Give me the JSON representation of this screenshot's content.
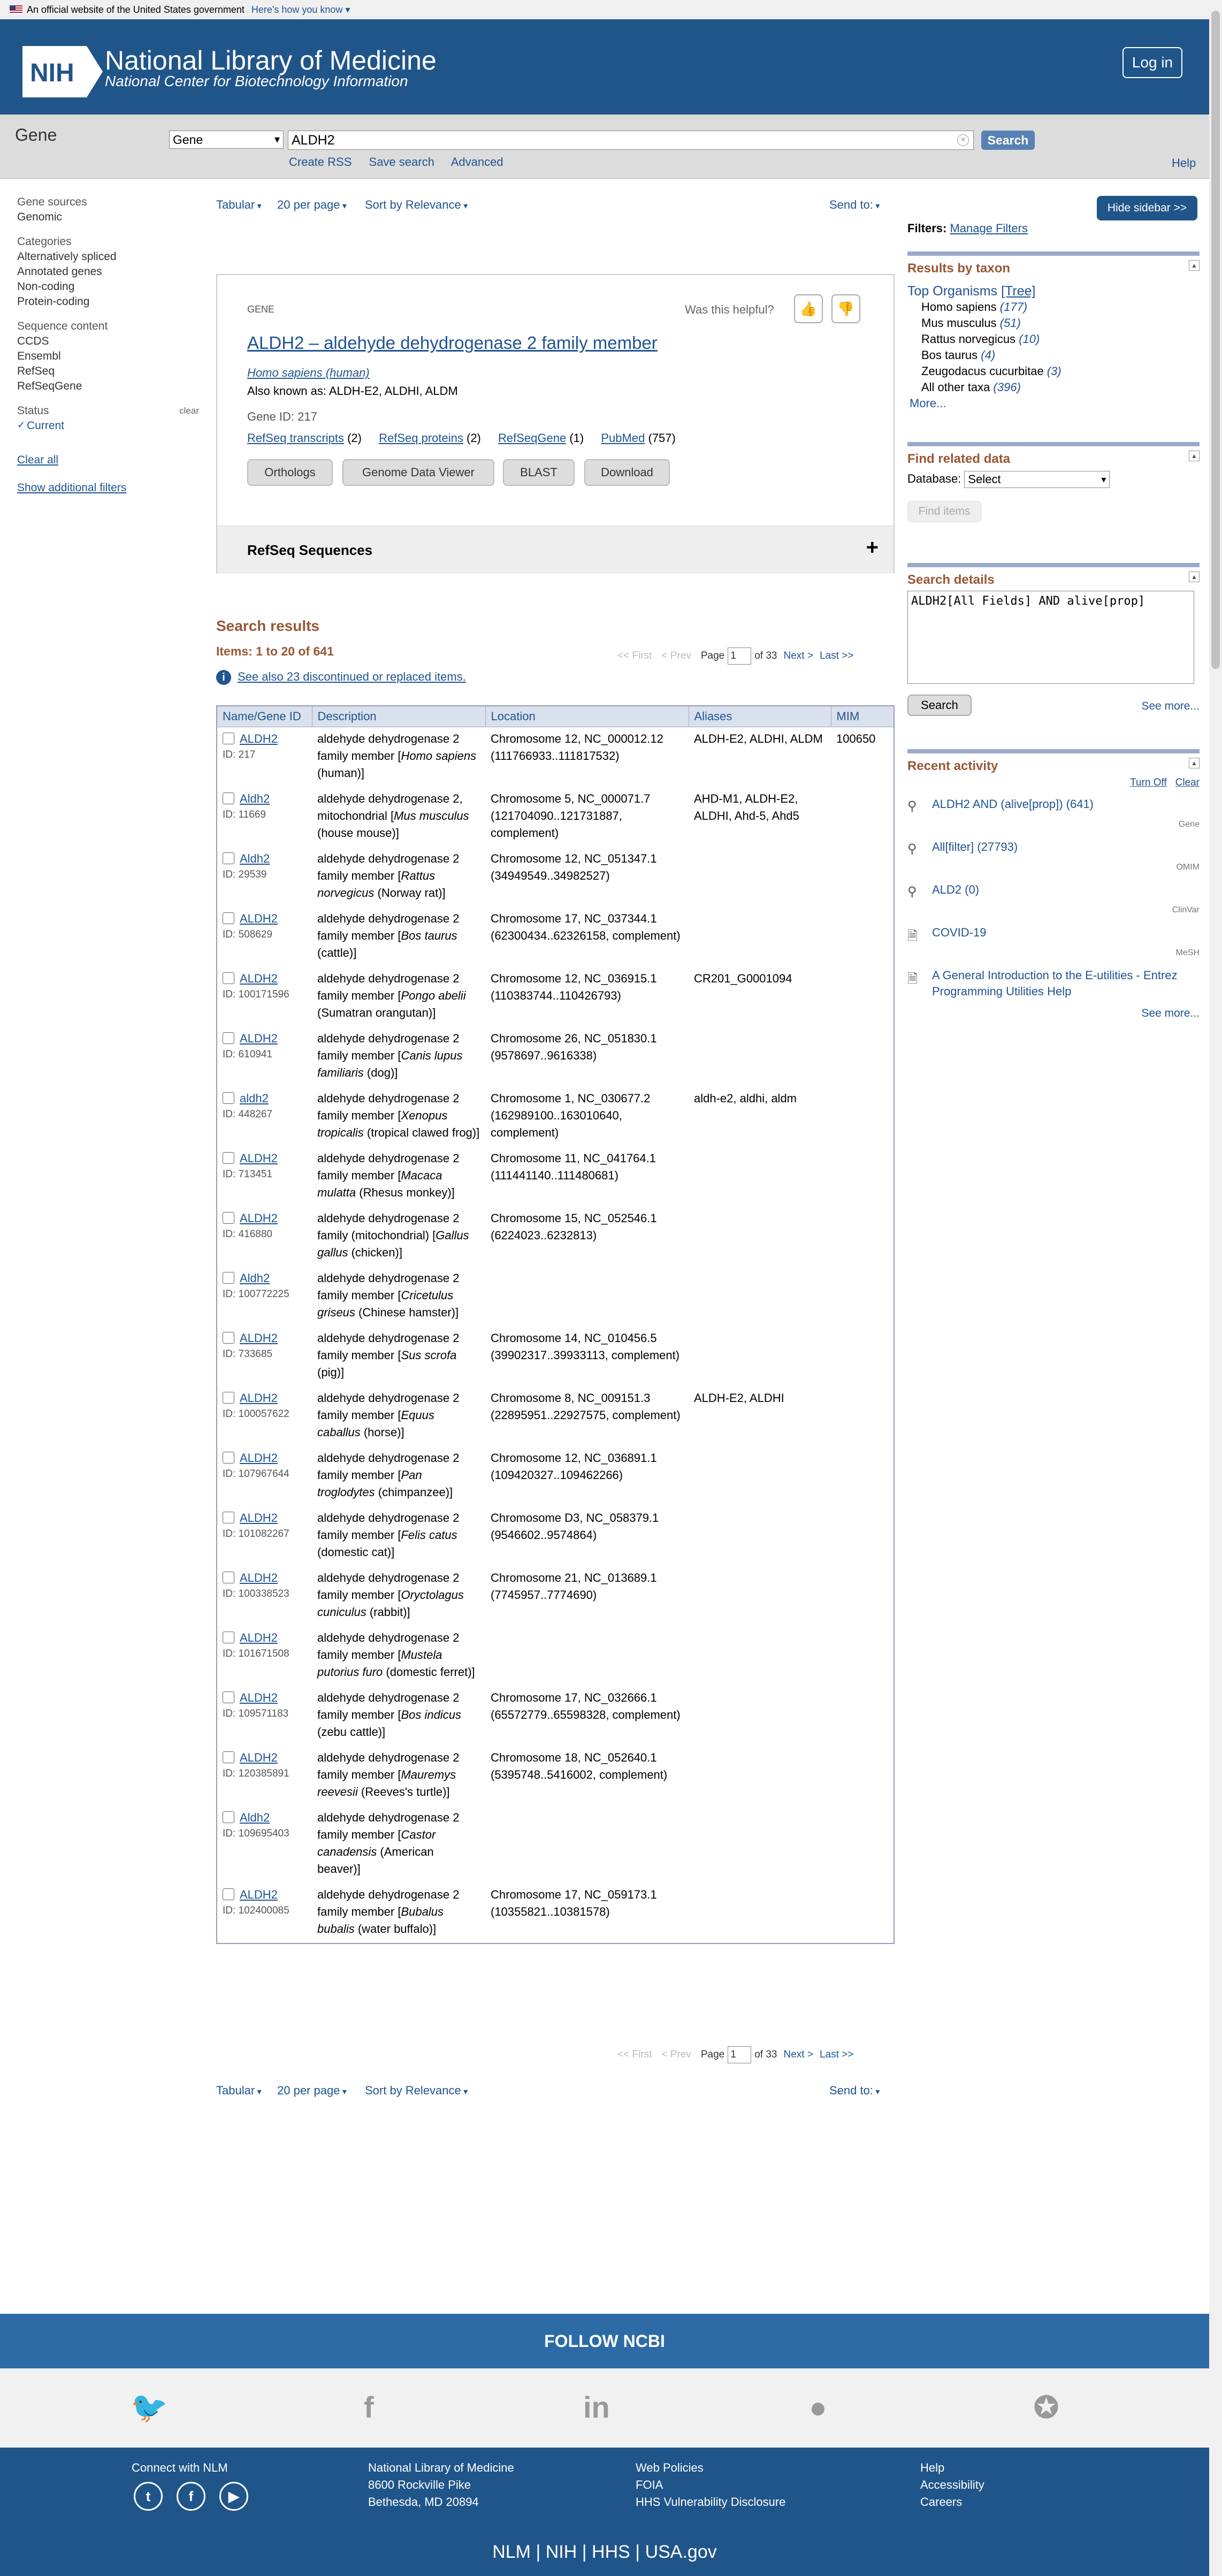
{
  "banner": {
    "text": "An official website of the United States government",
    "link": "Here's how you know"
  },
  "header": {
    "logo": "NIH",
    "title": "National Library of Medicine",
    "subtitle": "National Center for Biotechnology Information",
    "login": "Log in"
  },
  "search": {
    "db_name": "Gene",
    "db_select": "Gene",
    "term": "ALDH2",
    "button": "Search",
    "links": [
      "Create RSS",
      "Save search",
      "Advanced"
    ],
    "help": "Help"
  },
  "leftnav": {
    "gene_sources_h": "Gene sources",
    "gene_sources": [
      "Genomic"
    ],
    "categories_h": "Categories",
    "categories": [
      "Alternatively spliced",
      "Annotated genes",
      "Non-coding",
      "Protein-coding"
    ],
    "seq_h": "Sequence content",
    "seq": [
      "CCDS",
      "Ensembl",
      "RefSeq",
      "RefSeqGene"
    ],
    "status_h": "Status",
    "status_clear": "clear",
    "status_current": "Current",
    "clear_all": "Clear all",
    "show_filters": "Show additional filters"
  },
  "toolbar": {
    "format": "Tabular",
    "per_page": "20 per page",
    "sort": "Sort by Relevance",
    "send": "Send to:"
  },
  "gene_box": {
    "label": "GENE",
    "helpful": "Was this helpful?",
    "title": "ALDH2 – aldehyde dehydrogenase 2 family member",
    "organism": "Homo sapiens (human)",
    "aka": "Also known as: ALDH-E2, ALDHI, ALDM",
    "gene_id": "Gene ID: 217",
    "links": [
      {
        "label": "RefSeq transcripts",
        "count": "(2)"
      },
      {
        "label": "RefSeq proteins",
        "count": "(2)"
      },
      {
        "label": "RefSeqGene",
        "count": "(1)"
      },
      {
        "label": "PubMed",
        "count": "(757)"
      }
    ],
    "buttons": [
      "Orthologs",
      "Genome Data Viewer",
      "BLAST",
      "Download"
    ],
    "refseq": "RefSeq Sequences"
  },
  "results": {
    "title": "Search results",
    "items": "Items: 1 to 20 of 641",
    "see_also": "See also 23 discontinued or replaced items.",
    "pager": {
      "first": "<< First",
      "prev": "< Prev",
      "page_label": "Page",
      "page": "1",
      "of": "of 33",
      "next": "Next >",
      "last": "Last >>"
    },
    "columns": [
      "Name/Gene ID",
      "Description",
      "Location",
      "Aliases",
      "MIM"
    ],
    "rows": [
      {
        "name": "ALDH2",
        "id": "ID: 217",
        "d1": "aldehyde dehydrogenase 2 family member [",
        "sp": "Homo sapiens",
        "d2": " (human)]",
        "loc": "Chromosome 12, NC_000012.12 (111766933..111817532)",
        "alias": "ALDH-E2, ALDHI, ALDM",
        "mim": "100650"
      },
      {
        "name": "Aldh2",
        "id": "ID: 11669",
        "d1": "aldehyde dehydrogenase 2, mitochondrial [",
        "sp": "Mus musculus",
        "d2": " (house mouse)]",
        "loc": "Chromosome 5, NC_000071.7 (121704090..121731887, complement)",
        "alias": "AHD-M1, ALDH-E2, ALDHI, Ahd-5, Ahd5",
        "mim": ""
      },
      {
        "name": "Aldh2",
        "id": "ID: 29539",
        "d1": "aldehyde dehydrogenase 2 family member [",
        "sp": "Rattus norvegicus",
        "d2": " (Norway rat)]",
        "loc": "Chromosome 12, NC_051347.1 (34949549..34982527)",
        "alias": "",
        "mim": ""
      },
      {
        "name": "ALDH2",
        "id": "ID: 508629",
        "d1": "aldehyde dehydrogenase 2 family member [",
        "sp": "Bos taurus",
        "d2": " (cattle)]",
        "loc": "Chromosome 17, NC_037344.1 (62300434..62326158, complement)",
        "alias": "",
        "mim": ""
      },
      {
        "name": "ALDH2",
        "id": "ID: 100171596",
        "d1": "aldehyde dehydrogenase 2 family member [",
        "sp": "Pongo abelii",
        "d2": " (Sumatran orangutan)]",
        "loc": "Chromosome 12, NC_036915.1 (110383744..110426793)",
        "alias": "CR201_G0001094",
        "mim": ""
      },
      {
        "name": "ALDH2",
        "id": "ID: 610941",
        "d1": "aldehyde dehydrogenase 2 family member [",
        "sp": "Canis lupus familiaris",
        "d2": " (dog)]",
        "loc": "Chromosome 26, NC_051830.1 (9578697..9616338)",
        "alias": "",
        "mim": ""
      },
      {
        "name": "aldh2",
        "id": "ID: 448267",
        "d1": "aldehyde dehydrogenase 2 family member [",
        "sp": "Xenopus tropicalis",
        "d2": " (tropical clawed frog)]",
        "loc": "Chromosome 1, NC_030677.2 (162989100..163010640, complement)",
        "alias": "aldh-e2, aldhi, aldm",
        "mim": ""
      },
      {
        "name": "ALDH2",
        "id": "ID: 713451",
        "d1": "aldehyde dehydrogenase 2 family member [",
        "sp": "Macaca mulatta",
        "d2": " (Rhesus monkey)]",
        "loc": "Chromosome 11, NC_041764.1 (111441140..111480681)",
        "alias": "",
        "mim": ""
      },
      {
        "name": "ALDH2",
        "id": "ID: 416880",
        "d1": "aldehyde dehydrogenase 2 family (mitochondrial) [",
        "sp": "Gallus gallus",
        "d2": " (chicken)]",
        "loc": "Chromosome 15, NC_052546.1 (6224023..6232813)",
        "alias": "",
        "mim": ""
      },
      {
        "name": "Aldh2",
        "id": "ID: 100772225",
        "d1": "aldehyde dehydrogenase 2 family member [",
        "sp": "Cricetulus griseus",
        "d2": " (Chinese hamster)]",
        "loc": "",
        "alias": "",
        "mim": ""
      },
      {
        "name": "ALDH2",
        "id": "ID: 733685",
        "d1": "aldehyde dehydrogenase 2 family member [",
        "sp": "Sus scrofa",
        "d2": " (pig)]",
        "loc": "Chromosome 14, NC_010456.5 (39902317..39933113, complement)",
        "alias": "",
        "mim": ""
      },
      {
        "name": "ALDH2",
        "id": "ID: 100057622",
        "d1": "aldehyde dehydrogenase 2 family member [",
        "sp": "Equus caballus",
        "d2": " (horse)]",
        "loc": "Chromosome 8, NC_009151.3 (22895951..22927575, complement)",
        "alias": "ALDH-E2, ALDHI",
        "mim": ""
      },
      {
        "name": "ALDH2",
        "id": "ID: 107967644",
        "d1": "aldehyde dehydrogenase 2 family member [",
        "sp": "Pan troglodytes",
        "d2": " (chimpanzee)]",
        "loc": "Chromosome 12, NC_036891.1 (109420327..109462266)",
        "alias": "",
        "mim": ""
      },
      {
        "name": "ALDH2",
        "id": "ID: 101082267",
        "d1": "aldehyde dehydrogenase 2 family member [",
        "sp": "Felis catus",
        "d2": " (domestic cat)]",
        "loc": "Chromosome D3, NC_058379.1 (9546602..9574864)",
        "alias": "",
        "mim": ""
      },
      {
        "name": "ALDH2",
        "id": "ID: 100338523",
        "d1": "aldehyde dehydrogenase 2 family member [",
        "sp": "Oryctolagus cuniculus",
        "d2": " (rabbit)]",
        "loc": "Chromosome 21, NC_013689.1 (7745957..7774690)",
        "alias": "",
        "mim": ""
      },
      {
        "name": "ALDH2",
        "id": "ID: 101671508",
        "d1": "aldehyde dehydrogenase 2 family member [",
        "sp": "Mustela putorius furo",
        "d2": " (domestic ferret)]",
        "loc": "",
        "alias": "",
        "mim": ""
      },
      {
        "name": "ALDH2",
        "id": "ID: 109571183",
        "d1": "aldehyde dehydrogenase 2 family member [",
        "sp": "Bos indicus",
        "d2": " (zebu cattle)]",
        "loc": "Chromosome 17, NC_032666.1 (65572779..65598328, complement)",
        "alias": "",
        "mim": ""
      },
      {
        "name": "ALDH2",
        "id": "ID: 120385891",
        "d1": "aldehyde dehydrogenase 2 family member [",
        "sp": "Mauremys reevesii",
        "d2": " (Reeves's turtle)]",
        "loc": "Chromosome 18, NC_052640.1 (5395748..5416002, complement)",
        "alias": "",
        "mim": ""
      },
      {
        "name": "Aldh2",
        "id": "ID: 109695403",
        "d1": "aldehyde dehydrogenase 2 family member [",
        "sp": "Castor canadensis",
        "d2": " (American beaver)]",
        "loc": "",
        "alias": "",
        "mim": ""
      },
      {
        "name": "ALDH2",
        "id": "ID: 102400085",
        "d1": "aldehyde dehydrogenase 2 family member [",
        "sp": "Bubalus bubalis",
        "d2": " (water buffalo)]",
        "loc": "Chromosome 17, NC_059173.1 (10355821..10381578)",
        "alias": "",
        "mim": ""
      }
    ]
  },
  "sidebar": {
    "hide": "Hide sidebar >>",
    "filters": "Filters:",
    "manage": "Manage Filters",
    "taxon_title": "Results by taxon",
    "top_org": "Top Organisms",
    "tree": "[Tree]",
    "taxa": [
      {
        "name": "Homo sapiens",
        "count": "(177)"
      },
      {
        "name": "Mus musculus",
        "count": "(51)"
      },
      {
        "name": "Rattus norvegicus",
        "count": "(10)"
      },
      {
        "name": "Bos taurus",
        "count": "(4)"
      },
      {
        "name": "Zeugodacus cucurbitae",
        "count": "(3)"
      },
      {
        "name": "All other taxa",
        "count": "(396)"
      }
    ],
    "more": "More...",
    "related_title": "Find related data",
    "database_label": "Database:",
    "database_value": "Select",
    "find_items": "Find items",
    "details_title": "Search details",
    "details_query": "ALDH2[All Fields] AND alive[prop]",
    "details_search": "Search",
    "see_more": "See more...",
    "recent_title": "Recent activity",
    "turn_off": "Turn Off",
    "clear": "Clear",
    "recent": [
      {
        "text": "ALDH2 AND (alive[prop]) (641)",
        "db": "Gene",
        "icon": "search-icon"
      },
      {
        "text": "All[filter] (27793)",
        "db": "OMIM",
        "icon": "search-icon"
      },
      {
        "text": "ALD2 (0)",
        "db": "ClinVar",
        "icon": "search-icon"
      },
      {
        "text": "COVID-19",
        "db": "MeSH",
        "icon": "document-icon"
      },
      {
        "text": "A General Introduction to the E-utilities - Entrez Programming Utilities Help",
        "db": "",
        "icon": "document-icon"
      }
    ],
    "recent_more": "See more..."
  },
  "footer": {
    "follow": "FOLLOW NCBI",
    "connect": "Connect with NLM",
    "address": [
      "National Library of Medicine",
      "8600 Rockville Pike",
      "Bethesda, MD 20894"
    ],
    "policies": [
      "Web Policies",
      "FOIA",
      "HHS Vulnerability Disclosure"
    ],
    "help": [
      "Help",
      "Accessibility",
      "Careers"
    ],
    "bottom": [
      "NLM",
      "NIH",
      "HHS",
      "USA.gov"
    ]
  }
}
